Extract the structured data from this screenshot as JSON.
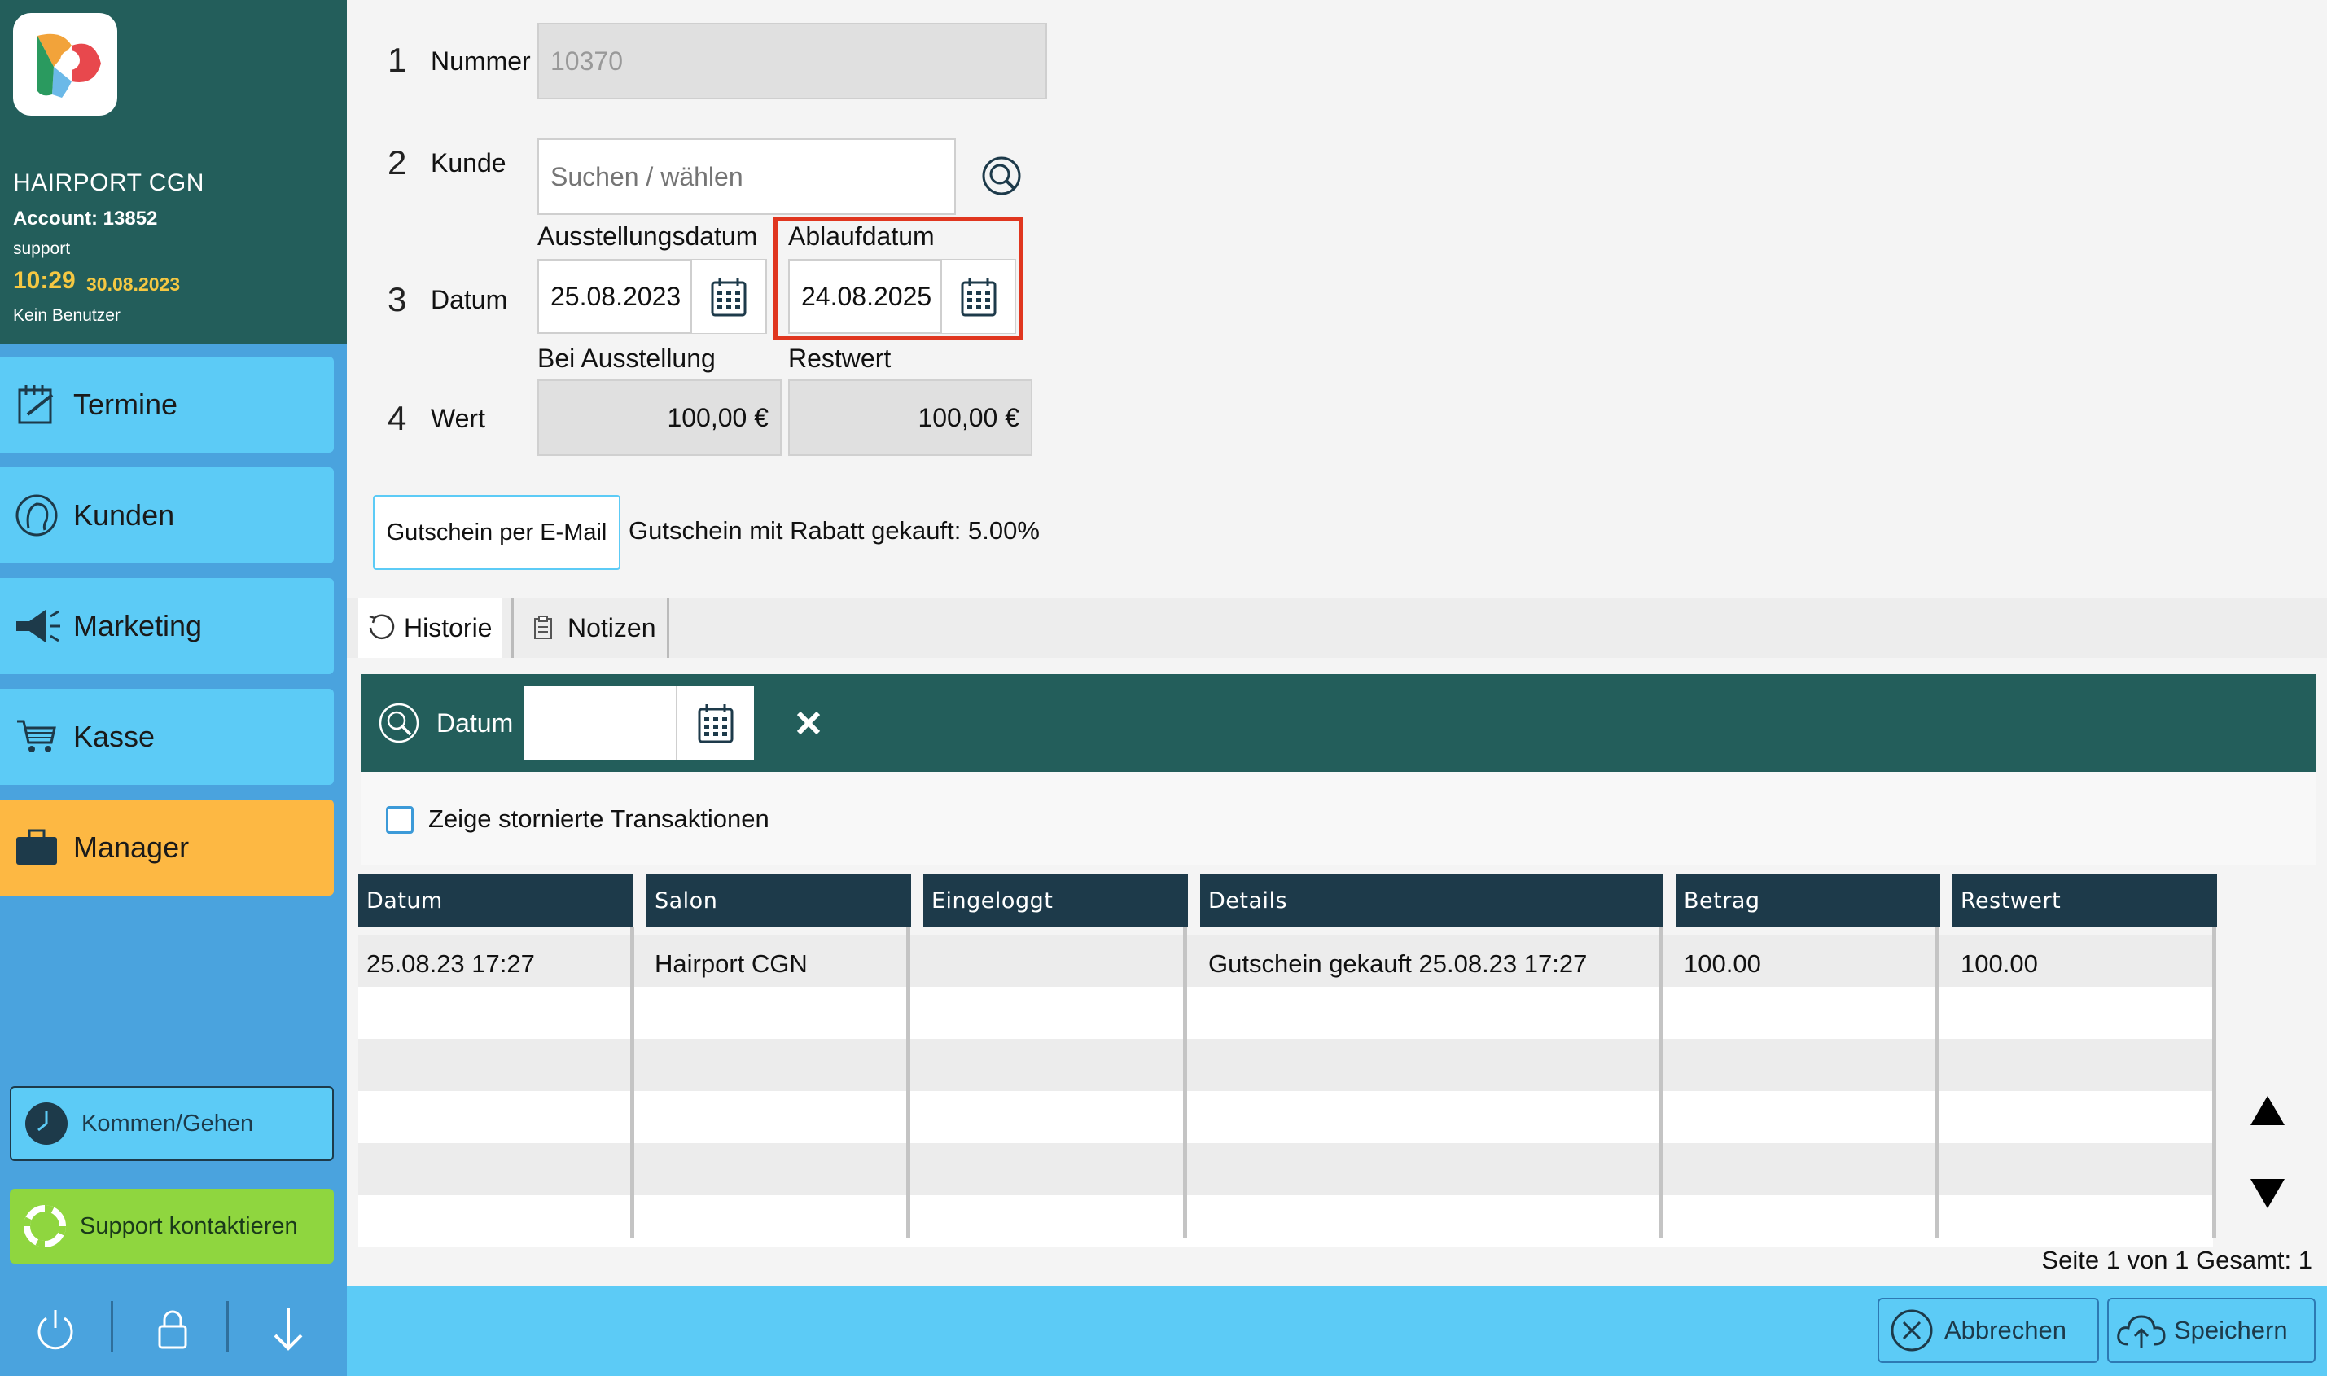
{
  "sidebar": {
    "salon_name": "HAIRPORT CGN",
    "account": "Account: 13852",
    "user": "support",
    "time": "10:29",
    "date": "30.08.2023",
    "no_user": "Kein Benutzer",
    "nav": [
      {
        "label": "Termine",
        "icon": "calendar-edit-icon"
      },
      {
        "label": "Kunden",
        "icon": "customer-head-icon"
      },
      {
        "label": "Marketing",
        "icon": "megaphone-icon"
      },
      {
        "label": "Kasse",
        "icon": "cart-icon"
      },
      {
        "label": "Manager",
        "icon": "briefcase-icon",
        "active": true
      }
    ],
    "kommen_gehen": "Kommen/Gehen",
    "support": "Support kontaktieren"
  },
  "form": {
    "nummer": {
      "step": "1",
      "label": "Nummer",
      "value": "10370"
    },
    "kunde": {
      "step": "2",
      "label": "Kunde",
      "placeholder": "Suchen / wählen"
    },
    "datum": {
      "step": "3",
      "label": "Datum",
      "ausstellung_label": "Ausstellungsdatum",
      "ausstellung_value": "25.08.2023",
      "ablauf_label": "Ablaufdatum",
      "ablauf_value": "24.08.2025"
    },
    "wert": {
      "step": "4",
      "label": "Wert",
      "bei_ausstellung_label": "Bei Ausstellung",
      "bei_ausstellung_value": "100,00 €",
      "restwert_label": "Restwert",
      "restwert_value": "100,00 €"
    },
    "email_button": "Gutschein per E-Mail",
    "discount_text": "Gutschein mit Rabatt gekauft: 5.00%"
  },
  "tabs": [
    {
      "label": "Historie",
      "active": true
    },
    {
      "label": "Notizen",
      "active": false
    }
  ],
  "filter": {
    "label": "Datum",
    "value": "",
    "show_cancelled_label": "Zeige stornierte Transaktionen",
    "show_cancelled": false
  },
  "table": {
    "headers": [
      "Datum",
      "Salon",
      "Eingeloggt",
      "Details",
      "Betrag",
      "Restwert"
    ],
    "rows": [
      [
        "25.08.23 17:27",
        "Hairport CGN",
        "",
        "Gutschein gekauft 25.08.23 17:27",
        "100.00",
        "100.00"
      ]
    ]
  },
  "pager": "Seite 1 von 1 Gesamt: 1",
  "footer": {
    "cancel": "Abbrechen",
    "save": "Speichern"
  },
  "colors": {
    "sidebar_head": "#235e5b",
    "sidebar_bg": "#4aa3de",
    "nav_bg": "#5ccbf6",
    "nav_active": "#fdb843",
    "support_bg": "#8fd63f",
    "highlight": "#e0361f",
    "table_header": "#1d3a4a"
  }
}
